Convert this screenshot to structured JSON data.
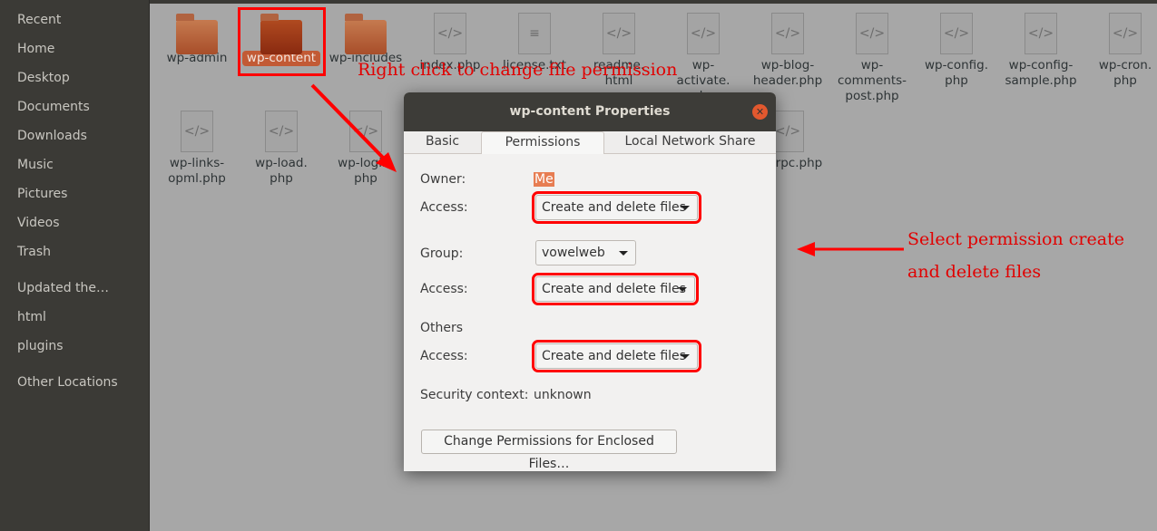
{
  "sidebar": {
    "items": [
      "Recent",
      "Home",
      "Desktop",
      "Documents",
      "Downloads",
      "Music",
      "Pictures",
      "Videos",
      "Trash"
    ],
    "bookmarks": [
      "Updated the…",
      "html",
      "plugins"
    ],
    "other": "Other Locations"
  },
  "files": [
    {
      "name": "wp-admin",
      "type": "folder"
    },
    {
      "name": "wp-content",
      "type": "folder",
      "selected": true
    },
    {
      "name": "wp-includes",
      "type": "folder"
    },
    {
      "name": "index.php",
      "type": "code"
    },
    {
      "name": "license.txt",
      "type": "text"
    },
    {
      "name": "readme.\nhtml",
      "type": "code"
    },
    {
      "name": "wp-\nactivate.\nphp",
      "type": "code"
    },
    {
      "name": "wp-blog-\nheader.php",
      "type": "code"
    },
    {
      "name": "wp-\ncomments-\npost.php",
      "type": "code"
    },
    {
      "name": "wp-config.\nphp",
      "type": "code"
    },
    {
      "name": "wp-config-\nsample.php",
      "type": "code"
    },
    {
      "name": "wp-cron.\nphp",
      "type": "code"
    },
    {
      "name": "wp-links-\nopml.php",
      "type": "code"
    },
    {
      "name": "wp-load.\nphp",
      "type": "code"
    },
    {
      "name": "wp-login.\nphp",
      "type": "code"
    },
    {
      "name": "xmlrpc.php",
      "type": "code"
    }
  ],
  "annotations": {
    "right_click": "Right click to change file permission",
    "select_line1": "Select permission create",
    "select_line2": "and delete files",
    "color": "#e10000"
  },
  "dialog": {
    "title": "wp-content Properties",
    "tabs": [
      "Basic",
      "Permissions",
      "Local Network Share"
    ],
    "active_tab": "Permissions",
    "owner_label": "Owner:",
    "owner_value": "Me",
    "access_label": "Access:",
    "owner_access": "Create and delete files",
    "group_label": "Group:",
    "group_value": "vowelweb",
    "group_access": "Create and delete files",
    "others_label": "Others",
    "others_access": "Create and delete files",
    "security_label": "Security context:",
    "security_value": "unknown",
    "enclosed_button": "Change Permissions for Enclosed Files…"
  }
}
